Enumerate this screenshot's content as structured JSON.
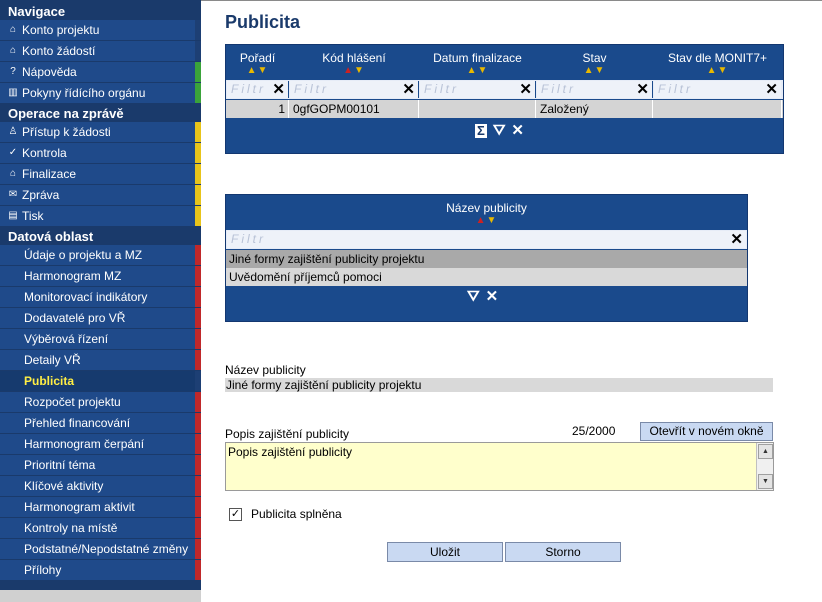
{
  "sidebar": {
    "navigace": {
      "title": "Navigace",
      "items": [
        {
          "label": "Konto projektu",
          "icon": "⌂",
          "bar": "#1d3f74"
        },
        {
          "label": "Konto žádostí",
          "icon": "⌂",
          "bar": "#1d3f74"
        },
        {
          "label": "Nápověda",
          "icon": "?",
          "bar": "#3aa33a"
        },
        {
          "label": "Pokyny řídícího orgánu",
          "icon": "▥",
          "bar": "#3aa33a"
        }
      ]
    },
    "operace": {
      "title": "Operace na zprávě",
      "items": [
        {
          "label": "Přístup k žádosti",
          "icon": "♙",
          "bar": "#e8c41a"
        },
        {
          "label": "Kontrola",
          "icon": "✓",
          "bar": "#e8c41a"
        },
        {
          "label": "Finalizace",
          "icon": "⌂",
          "bar": "#e8c41a"
        },
        {
          "label": "Zpráva",
          "icon": "✉",
          "bar": "#e8c41a"
        },
        {
          "label": "Tisk",
          "icon": "▤",
          "bar": "#e8c41a"
        }
      ]
    },
    "datova": {
      "title": "Datová oblast",
      "items": [
        {
          "label": "Údaje o projektu a MZ",
          "bar": "#c0282a"
        },
        {
          "label": "Harmonogram MZ",
          "bar": "#c0282a"
        },
        {
          "label": "Monitorovací indikátory",
          "bar": "#c0282a"
        },
        {
          "label": "Dodavatelé pro VŘ",
          "bar": "#c0282a"
        },
        {
          "label": "Výběrová řízení",
          "bar": "#c0282a"
        },
        {
          "label": "Detaily VŘ",
          "bar": "#c0282a"
        },
        {
          "label": "Publicita",
          "bar": "#1d3f74",
          "active": true
        },
        {
          "label": "Rozpočet projektu",
          "bar": "#c0282a"
        },
        {
          "label": "Přehled financování",
          "bar": "#c0282a"
        },
        {
          "label": "Harmonogram čerpání",
          "bar": "#c0282a"
        },
        {
          "label": "Prioritní téma",
          "bar": "#c0282a"
        },
        {
          "label": "Klíčové aktivity",
          "bar": "#c0282a"
        },
        {
          "label": "Harmonogram aktivit",
          "bar": "#c0282a"
        },
        {
          "label": "Kontroly na místě",
          "bar": "#c0282a"
        },
        {
          "label": "Podstatné/Nepodstatné změny",
          "bar": "#c0282a"
        },
        {
          "label": "Přílohy",
          "bar": "#c0282a"
        }
      ]
    }
  },
  "main": {
    "title": "Publicita",
    "grid1": {
      "columns": [
        {
          "label": "Pořadí",
          "sort_up_active": false
        },
        {
          "label": "Kód hlášení",
          "sort_up_active": true
        },
        {
          "label": "Datum finalizace",
          "sort_up_active": false
        },
        {
          "label": "Stav",
          "sort_up_active": false
        },
        {
          "label": "Stav dle MONIT7+",
          "sort_up_active": false
        }
      ],
      "filter_placeholders": [
        "Filtr",
        "Filtr",
        "Filtr",
        "Filtr",
        "Filtr"
      ],
      "rows": [
        [
          "1",
          "0gfGOPM00101",
          "",
          "Založený",
          ""
        ]
      ]
    },
    "grid2": {
      "column": "Název publicity",
      "filter_placeholder": "Filtr",
      "rows": [
        "Jiné formy zajištění publicity projektu",
        "Uvědomění příjemců pomoci"
      ]
    },
    "detail": {
      "name_label": "Název publicity",
      "name_value": "Jiné formy zajištění publicity projektu",
      "desc_label": "Popis zajištění publicity",
      "counter": "25/2000",
      "open_window_button": "Otevřít v novém okně",
      "desc_value": "Popis zajištění publicity",
      "checkbox_label": "Publicita splněna",
      "checkbox_checked": true
    },
    "buttons": {
      "save": "Uložit",
      "cancel": "Storno"
    }
  }
}
